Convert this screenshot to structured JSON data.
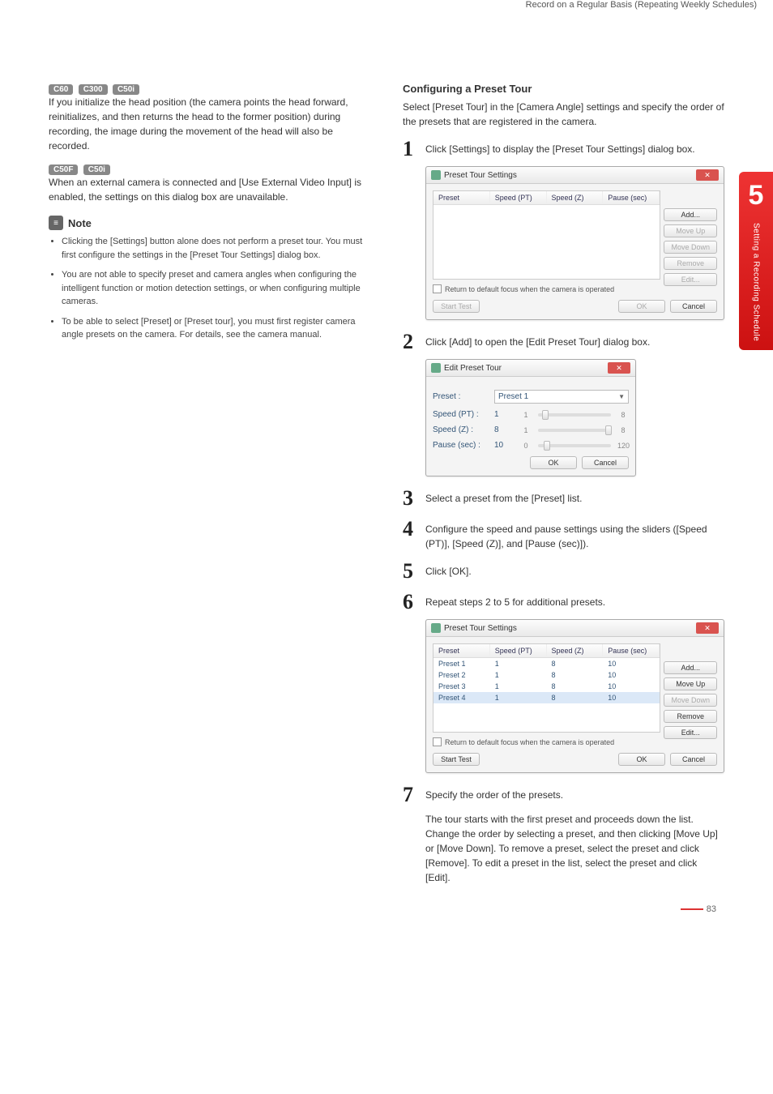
{
  "header": "Record on a Regular Basis (Repeating Weekly Schedules)",
  "left": {
    "badges1": [
      "C60",
      "C300",
      "C50i"
    ],
    "para1": "If you initialize the head position (the camera points the head forward, reinitializes, and then returns the head to the former position) during recording, the image during the movement of the head will also be recorded.",
    "badges2": [
      "C50F",
      "C50i"
    ],
    "para2": "When an external camera is connected and [Use External Video Input] is enabled, the settings on this dialog box are unavailable.",
    "note_label": "Note",
    "notes": [
      "Clicking the [Settings] button alone does not perform a preset tour. You must first configure the settings in the [Preset Tour Settings] dialog box.",
      "You are not able to specify preset and camera angles when configuring the intelligent function or motion detection settings, or when configuring multiple cameras.",
      "To be able to select [Preset] or [Preset tour], you must first register camera angle presets on the camera. For details, see the camera manual."
    ]
  },
  "right": {
    "heading": "Configuring a Preset Tour",
    "intro": "Select [Preset Tour] in the [Camera Angle] settings and specify the order of the presets that are registered in the camera.",
    "steps": {
      "s1": "Click [Settings] to display the [Preset Tour Settings] dialog box.",
      "s2": "Click [Add] to open the [Edit Preset Tour] dialog box.",
      "s3": "Select a preset from the [Preset] list.",
      "s4": "Configure the speed and pause settings using the sliders ([Speed (PT)], [Speed (Z)], and [Pause (sec)]).",
      "s5": "Click [OK].",
      "s6": "Repeat steps 2 to 5 for additional presets.",
      "s7": "Specify the order of the presets.",
      "s7body": "The tour starts with the first preset and proceeds down the list. Change the order by selecting a preset, and then clicking [Move Up] or [Move Down]. To remove a preset, select the preset and click [Remove]. To edit a preset in the list, select the preset and click [Edit]."
    }
  },
  "dialog1": {
    "title": "Preset Tour Settings",
    "cols": [
      "Preset",
      "Speed (PT)",
      "Speed (Z)",
      "Pause (sec)"
    ],
    "buttons": {
      "add": "Add...",
      "moveup": "Move Up",
      "movedown": "Move Down",
      "remove": "Remove",
      "edit": "Edit..."
    },
    "checkbox": "Return to default focus when the camera is operated",
    "start": "Start Test",
    "ok": "OK",
    "cancel": "Cancel"
  },
  "dialog_edit": {
    "title": "Edit Preset Tour",
    "preset_label": "Preset :",
    "preset_value": "Preset 1",
    "rows": [
      {
        "label": "Speed (PT) :",
        "val": "1",
        "min": "1",
        "max": "8",
        "pos": 5
      },
      {
        "label": "Speed (Z) :",
        "val": "8",
        "min": "1",
        "max": "8",
        "pos": 95
      },
      {
        "label": "Pause (sec) :",
        "val": "10",
        "min": "0",
        "max": "120",
        "pos": 10
      }
    ],
    "ok": "OK",
    "cancel": "Cancel"
  },
  "dialog2": {
    "title": "Preset Tour Settings",
    "cols": [
      "Preset",
      "Speed (PT)",
      "Speed (Z)",
      "Pause (sec)"
    ],
    "rows": [
      {
        "c": [
          "Preset 1",
          "1",
          "8",
          "10"
        ],
        "sel": false
      },
      {
        "c": [
          "Preset 2",
          "1",
          "8",
          "10"
        ],
        "sel": false
      },
      {
        "c": [
          "Preset 3",
          "1",
          "8",
          "10"
        ],
        "sel": false
      },
      {
        "c": [
          "Preset 4",
          "1",
          "8",
          "10"
        ],
        "sel": true
      }
    ],
    "buttons": {
      "add": "Add...",
      "moveup": "Move Up",
      "movedown": "Move Down",
      "remove": "Remove",
      "edit": "Edit..."
    },
    "checkbox": "Return to default focus when the camera is operated",
    "start": "Start Test",
    "ok": "OK",
    "cancel": "Cancel"
  },
  "sidetab": {
    "num": "5",
    "text": "Setting a Recording Schedule"
  },
  "pagenum": "83"
}
